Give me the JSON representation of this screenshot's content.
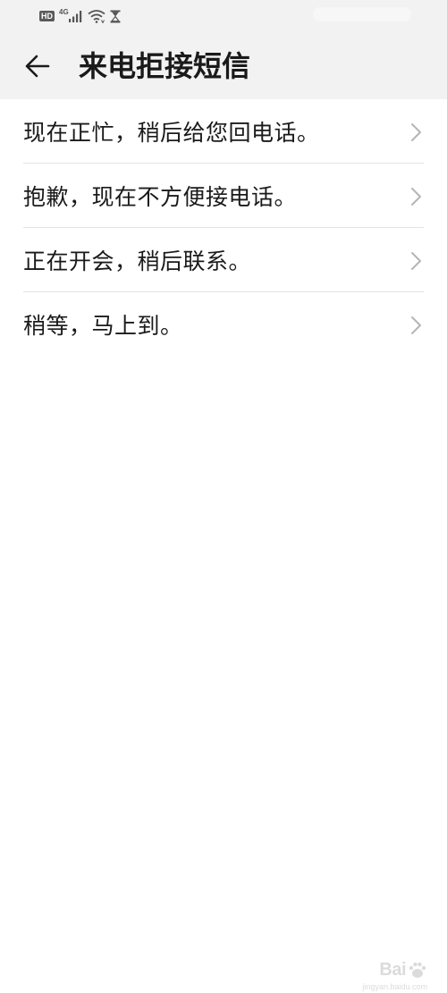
{
  "status_bar": {
    "hd_label": "HD",
    "network_label": "4G"
  },
  "header": {
    "title": "来电拒接短信"
  },
  "messages": [
    {
      "label": "现在正忙，稍后给您回电话。"
    },
    {
      "label": "抱歉，现在不方便接电话。"
    },
    {
      "label": "正在开会，稍后联系。"
    },
    {
      "label": "稍等，马上到。"
    }
  ],
  "watermark": {
    "logo_text": "Bai",
    "sub_text": "jingyan.baidu.com"
  },
  "colors": {
    "header_background": "#f2f2f2",
    "background": "#ffffff",
    "text": "#1a1a1a",
    "chevron": "#b5b5b5",
    "divider": "#e3e3e3"
  },
  "icons": {
    "back": "arrow-left-icon",
    "chevron": "chevron-right-icon",
    "signal": "cell-signal-icon",
    "wifi": "wifi-icon",
    "alarm": "hourglass-icon"
  }
}
